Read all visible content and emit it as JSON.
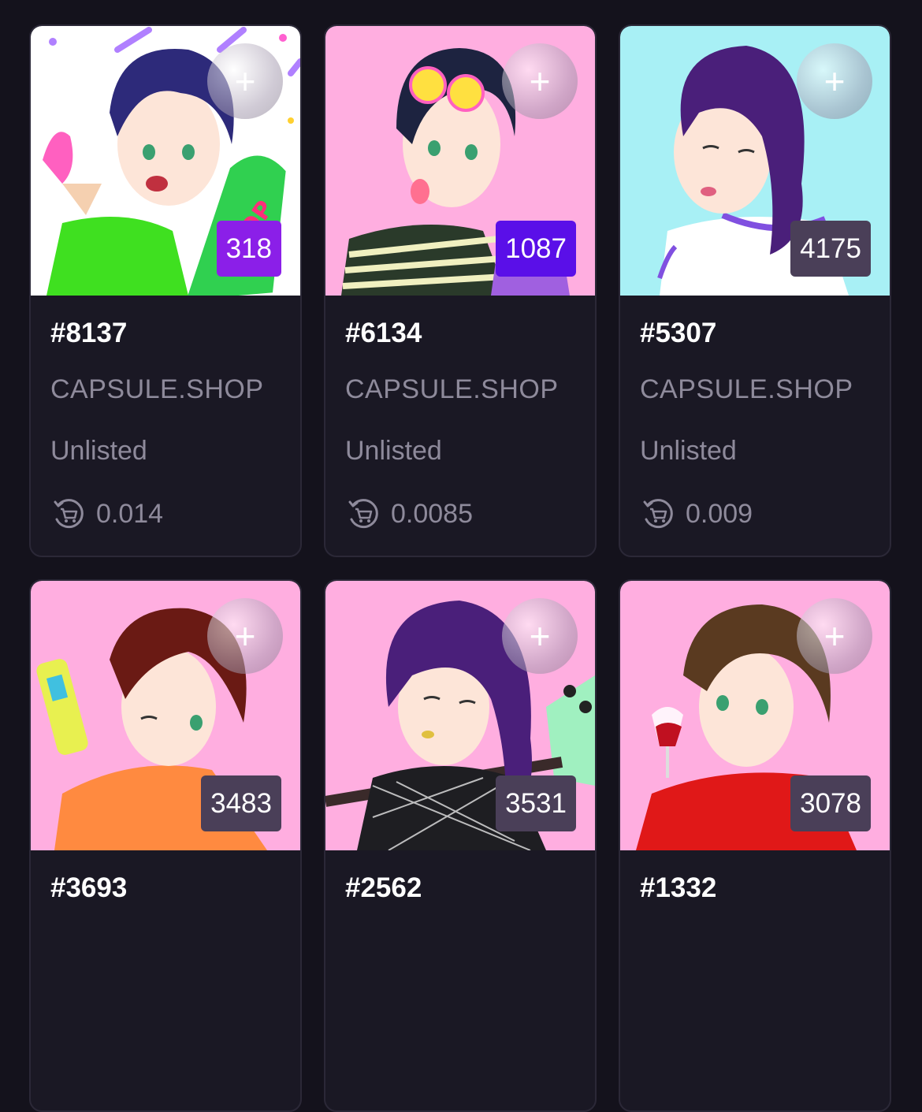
{
  "add_label": "+",
  "collection_name": "CAPSULE.SHOP",
  "cards": [
    {
      "id": "#8137",
      "rank": "318",
      "status": "Unlisted",
      "price": "0.014",
      "bg": "#ffffff",
      "hair": "#2d2a7a",
      "badge_color": "#8b1fe8",
      "accent": "#3fe020"
    },
    {
      "id": "#6134",
      "rank": "1087",
      "status": "Unlisted",
      "price": "0.0085",
      "bg": "#ffaee0",
      "hair": "#1d2340",
      "badge_color": "#5a0fe8",
      "accent": "#2a3a2a"
    },
    {
      "id": "#5307",
      "rank": "4175",
      "status": "Unlisted",
      "price": "0.009",
      "bg": "#a8f0f5",
      "hair": "#4a1f7a",
      "badge_color": "#4a3f58",
      "accent": "#ffffff"
    },
    {
      "id": "#3693",
      "rank": "3483",
      "status": "",
      "price": "",
      "bg": "#ffaee0",
      "hair": "#6a1a14",
      "badge_color": "#4a3f58",
      "accent": "#ff8a40"
    },
    {
      "id": "#2562",
      "rank": "3531",
      "status": "",
      "price": "",
      "bg": "#ffaee0",
      "hair": "#4a1f7a",
      "badge_color": "#4a3f58",
      "accent": "#1e1e22"
    },
    {
      "id": "#1332",
      "rank": "3078",
      "status": "",
      "price": "",
      "bg": "#ffaee0",
      "hair": "#5a3a20",
      "badge_color": "#4a3f58",
      "accent": "#e01818"
    }
  ]
}
